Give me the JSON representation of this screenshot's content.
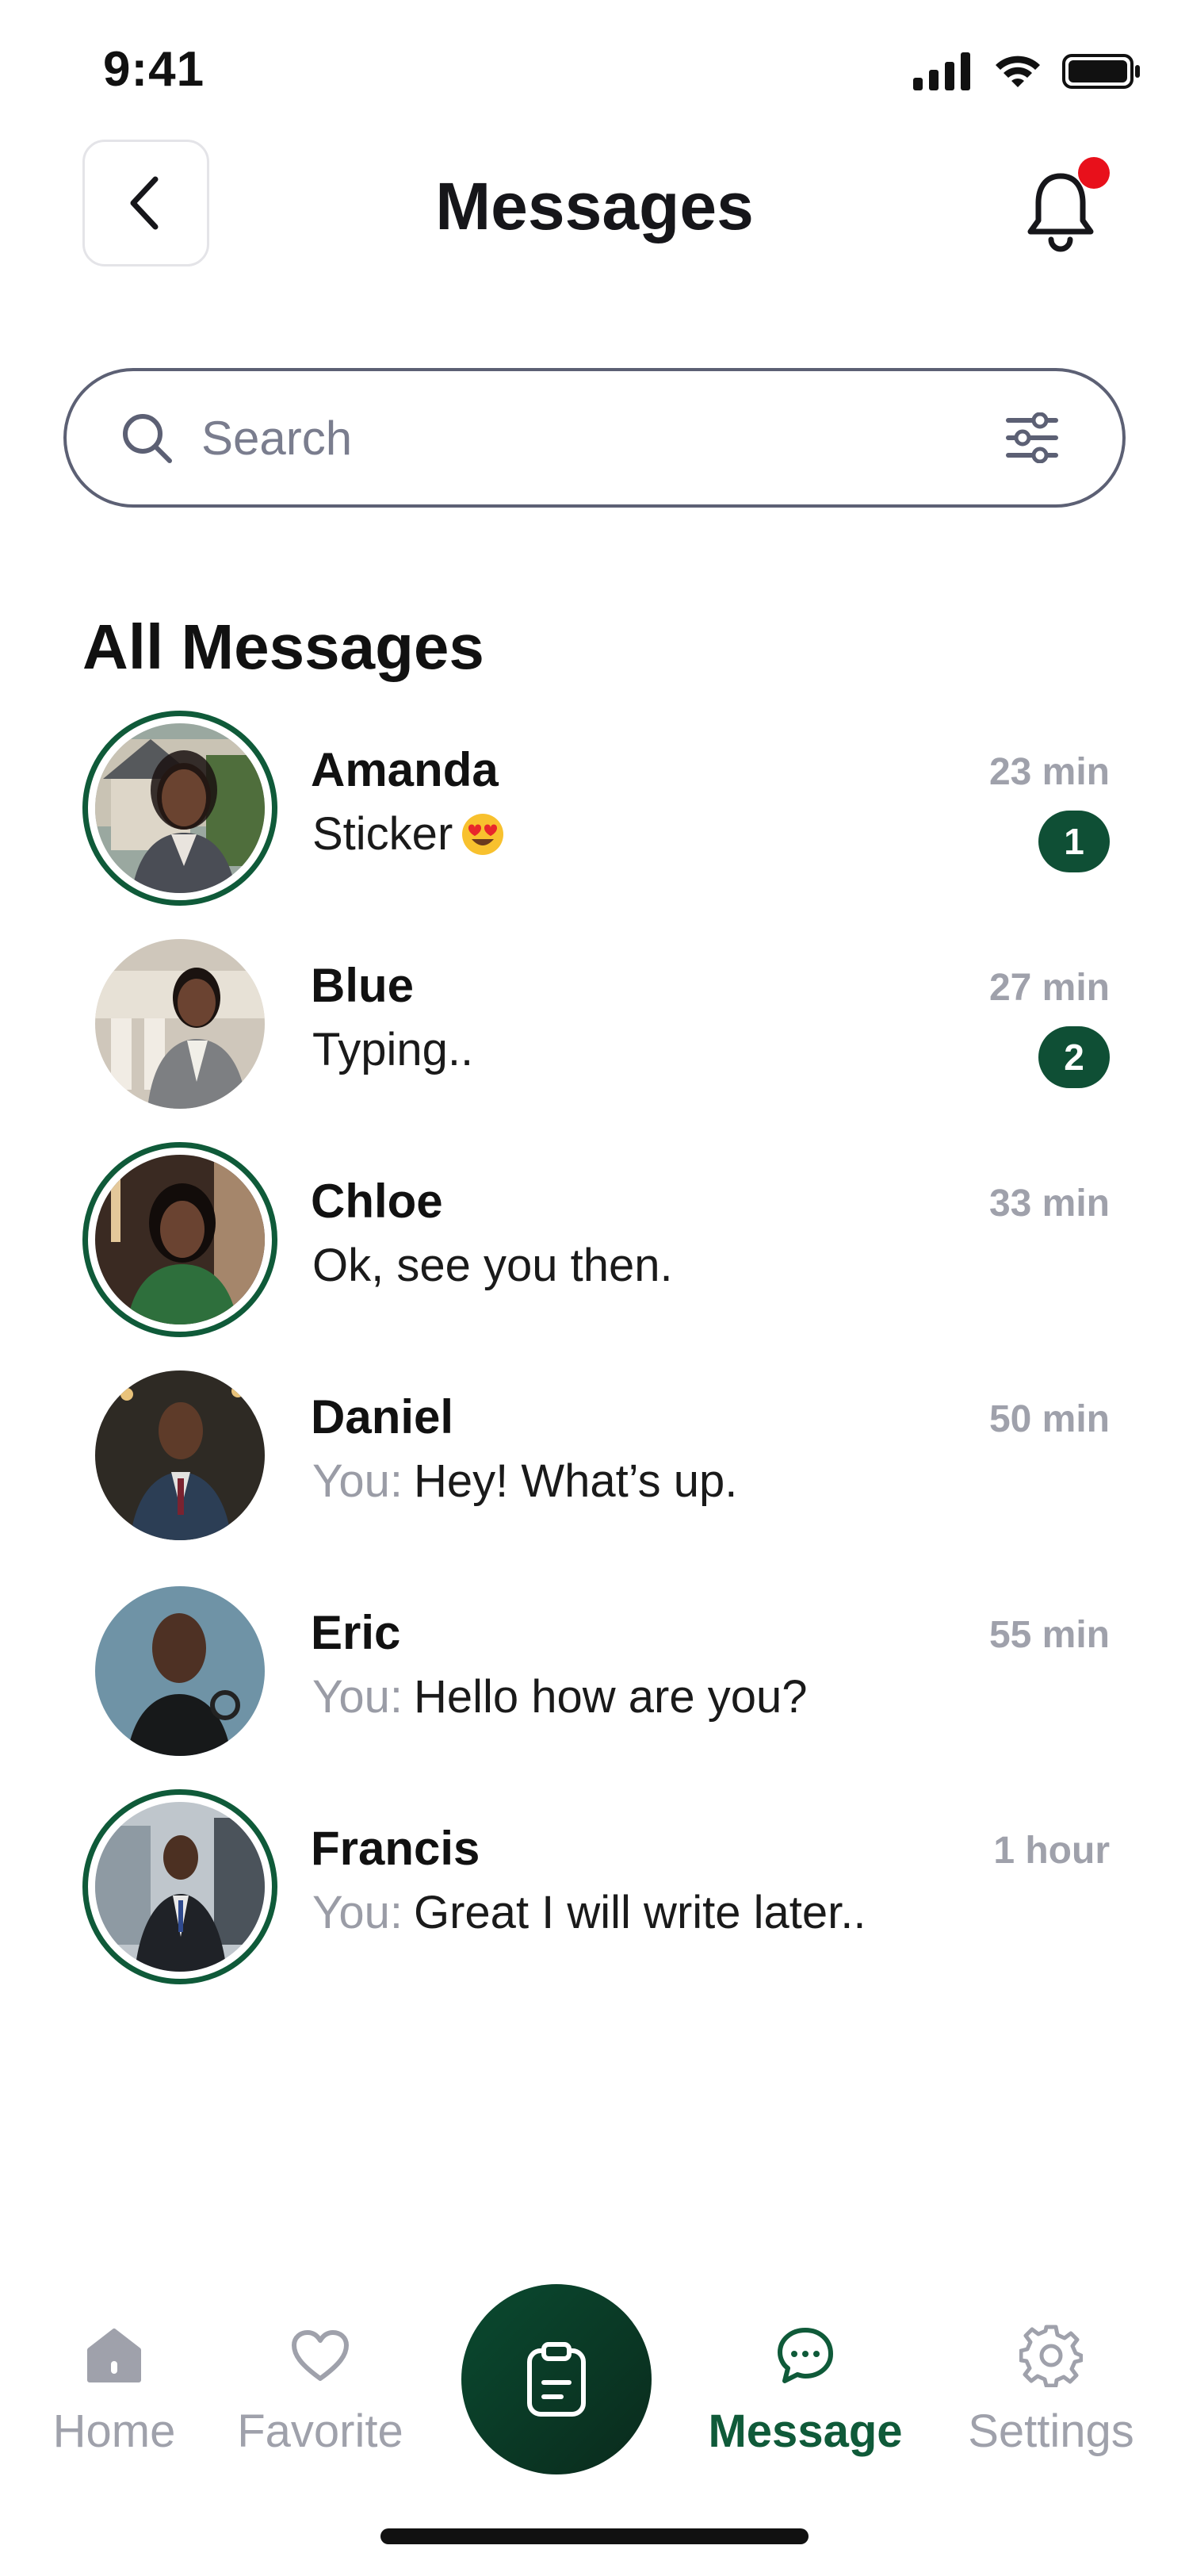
{
  "status_bar": {
    "time": "9:41"
  },
  "header": {
    "title": "Messages"
  },
  "search": {
    "placeholder": "Search"
  },
  "section": {
    "title": "All Messages"
  },
  "messages": [
    {
      "name": "Amanda",
      "prefix": "",
      "preview": "Sticker",
      "time": "23 min",
      "badge": "1",
      "ring": true
    },
    {
      "name": "Blue",
      "prefix": "",
      "preview": "Typing..",
      "time": "27 min",
      "badge": "2",
      "ring": false
    },
    {
      "name": "Chloe",
      "prefix": "",
      "preview": "Ok, see you then.",
      "time": "33 min",
      "badge": "",
      "ring": true
    },
    {
      "name": "Daniel",
      "prefix": "You:",
      "preview": "Hey! What’s up.",
      "time": "50 min",
      "badge": "",
      "ring": false
    },
    {
      "name": "Eric",
      "prefix": "You:",
      "preview": "Hello how are you?",
      "time": "55 min",
      "badge": "",
      "ring": false
    },
    {
      "name": "Francis",
      "prefix": "You:",
      "preview": "Great I will write later..",
      "time": "1 hour",
      "badge": "",
      "ring": true
    }
  ],
  "bottom_nav": {
    "home": "Home",
    "favorite": "Favorite",
    "message": "Message",
    "settings": "Settings"
  },
  "icons": {
    "back": "chevron-left-icon",
    "notification": "bell-icon",
    "search": "search-icon",
    "filter": "sliders-icon",
    "center": "clipboard-icon"
  },
  "colors": {
    "accent": "#0f5a39",
    "badge": "#0f4f35",
    "notification_dot": "#e8101b",
    "muted": "#9fa1ab"
  }
}
